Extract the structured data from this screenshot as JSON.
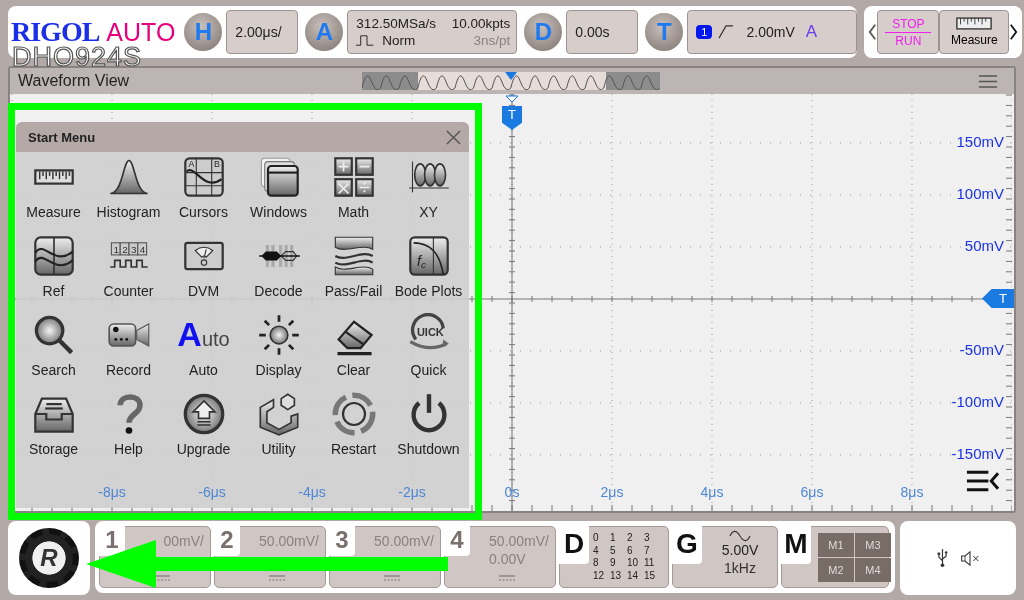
{
  "header": {
    "logo": "RIGOL",
    "mode": "AUTO",
    "model": "DHO924S"
  },
  "horizontal": {
    "letter": "H",
    "scale": "2.00μs/"
  },
  "acquire": {
    "letter": "A",
    "sample_rate": "312.50MSa/s",
    "memory_depth": "10.00kpts",
    "mode": "Norm",
    "resolution": "3ns/pt"
  },
  "delay": {
    "letter": "D",
    "value": "0.00s"
  },
  "trigger": {
    "letter": "T",
    "source": "1",
    "threshold": "2.00mV",
    "sweep": "A"
  },
  "quick_buttons": {
    "stop": "STOP",
    "run": "RUN",
    "measure": "Measure"
  },
  "waveform_view": {
    "title": "Waveform View",
    "trigger_marker": "T",
    "level_marker": "T",
    "time_labels": [
      "-8μs",
      "-6μs",
      "-4μs",
      "-2μs",
      "0s",
      "2μs",
      "4μs",
      "6μs",
      "8μs"
    ],
    "voltage_labels": [
      "150mV",
      "100mV",
      "50mV",
      "-50mV",
      "-100mV",
      "-150mV"
    ]
  },
  "start_menu": {
    "title": "Start Menu",
    "items": [
      {
        "label": "Measure"
      },
      {
        "label": "Histogram"
      },
      {
        "label": "Cursors",
        "icon_text": [
          "A",
          "B"
        ]
      },
      {
        "label": "Windows"
      },
      {
        "label": "Math"
      },
      {
        "label": "XY"
      },
      {
        "label": "Ref"
      },
      {
        "label": "Counter",
        "icon_text": [
          "1",
          "2",
          "3",
          "4"
        ]
      },
      {
        "label": "DVM"
      },
      {
        "label": "Decode"
      },
      {
        "label": "Pass/Fail"
      },
      {
        "label": "Bode Plots",
        "icon_text": [
          "f",
          "c"
        ]
      },
      {
        "label": "Search"
      },
      {
        "label": "Record"
      },
      {
        "label": "Auto",
        "icon_text": [
          "A",
          "uto"
        ]
      },
      {
        "label": "Display"
      },
      {
        "label": "Clear"
      },
      {
        "label": "Quick",
        "icon_text": [
          "UICK"
        ]
      },
      {
        "label": "Storage"
      },
      {
        "label": "Help"
      },
      {
        "label": "Upgrade"
      },
      {
        "label": "Utility"
      },
      {
        "label": "Restart"
      },
      {
        "label": "Shutdown"
      }
    ]
  },
  "bottom": {
    "logo_letter": "R",
    "channels": [
      {
        "number": "1",
        "scale": "00mV/"
      },
      {
        "number": "2",
        "scale": "50.00mV/"
      },
      {
        "number": "3",
        "scale": "50.00mV/"
      },
      {
        "number": "4",
        "scale": "50.00mV/",
        "offset": "0.00V"
      }
    ],
    "digital": {
      "letter": "D",
      "bits": [
        "0",
        "1",
        "2",
        "3",
        "4",
        "5",
        "6",
        "7",
        "8",
        "9",
        "10",
        "11",
        "12",
        "13",
        "14",
        "15"
      ]
    },
    "generator": {
      "letter": "G",
      "amplitude": "5.00V",
      "frequency": "1kHz"
    },
    "math": {
      "letter": "M",
      "slots": [
        "M1",
        "M3",
        "M2",
        "M4"
      ]
    }
  }
}
